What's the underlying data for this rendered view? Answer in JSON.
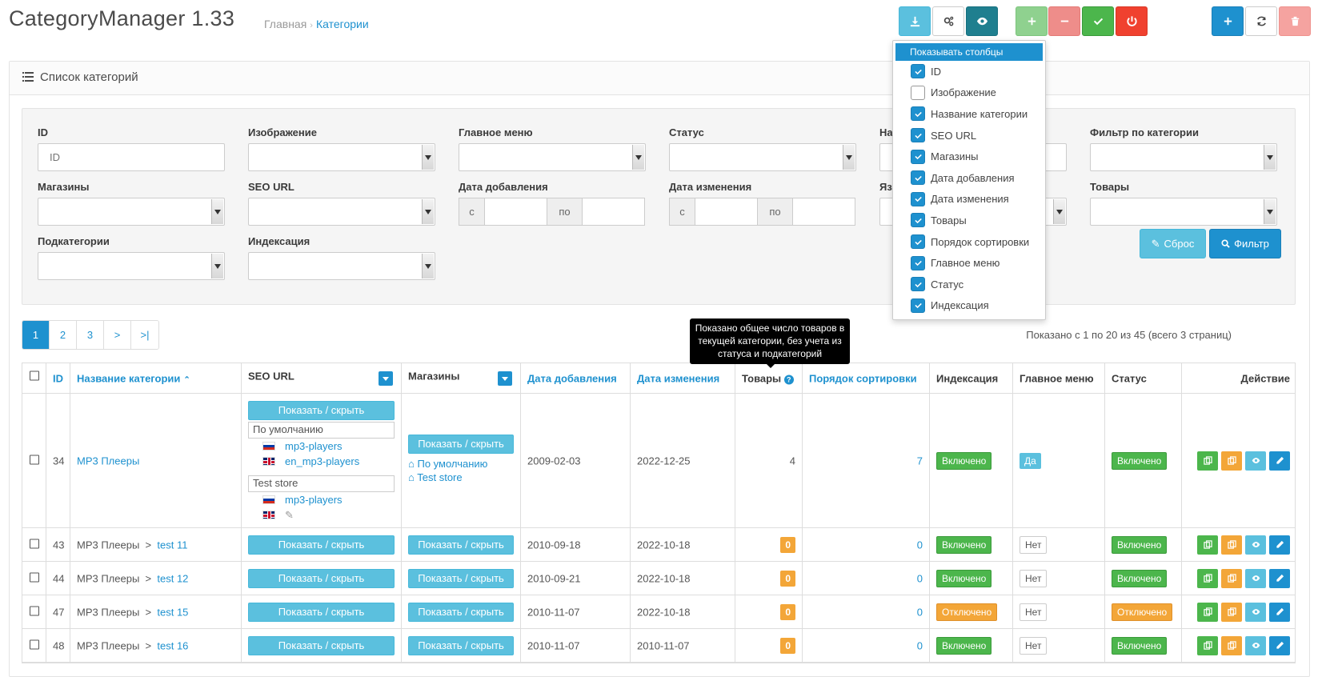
{
  "header": {
    "title": "CategoryManager 1.33",
    "breadcrumb": [
      "Главная",
      "Категории"
    ]
  },
  "toolbar": {
    "buttons": [
      {
        "icon": "download-icon",
        "color": "#5bc0de"
      },
      {
        "icon": "cogs-icon",
        "color": "#ffffff"
      },
      {
        "icon": "eye-icon",
        "color": "#1f7f8f"
      },
      {
        "icon": "plus-icon",
        "color": "#8fd18f"
      },
      {
        "icon": "minus-icon",
        "color": "#ee8d8a"
      },
      {
        "icon": "check-icon",
        "color": "#4cb64c"
      },
      {
        "icon": "power-icon",
        "color": "#f0412f"
      },
      {
        "icon": "plus-icon",
        "color": "#1e91cf"
      },
      {
        "icon": "refresh-icon",
        "color": "#ffffff"
      },
      {
        "icon": "trash-icon",
        "color": "#f5a3a0"
      }
    ]
  },
  "panel": {
    "title": "Список категорий"
  },
  "filters": {
    "id_label": "ID",
    "id_placeholder": "ID",
    "image_label": "Изображение",
    "main_menu_label": "Главное меню",
    "status_label": "Статус",
    "name_label_partial": "На",
    "category_filter_label": "Фильтр по категории",
    "stores_label": "Магазины",
    "seo_url_label": "SEO URL",
    "date_added_label": "Дата добавления",
    "date_modified_label": "Дата изменения",
    "language_label_partial": "Яз",
    "products_label": "Товары",
    "subcategories_label": "Подкатегории",
    "indexing_label": "Индексация",
    "date_from": "с",
    "date_to": "по",
    "reset_label": "Сброс",
    "filter_label": "Фильтр"
  },
  "pagination": {
    "pages": [
      "1",
      "2",
      "3",
      ">",
      ">|"
    ],
    "active": "1",
    "summary": "Показано с 1 по 20 из 45 (всего 3 страниц)"
  },
  "columns_menu": {
    "header": "Показывать столбцы",
    "options": [
      {
        "label": "ID",
        "checked": true
      },
      {
        "label": "Изображение",
        "checked": false
      },
      {
        "label": "Название категории",
        "checked": true
      },
      {
        "label": "SEO URL",
        "checked": true
      },
      {
        "label": "Магазины",
        "checked": true
      },
      {
        "label": "Дата добавления",
        "checked": true
      },
      {
        "label": "Дата изменения",
        "checked": true
      },
      {
        "label": "Товары",
        "checked": true
      },
      {
        "label": "Порядок сортировки",
        "checked": true
      },
      {
        "label": "Главное меню",
        "checked": true
      },
      {
        "label": "Статус",
        "checked": true
      },
      {
        "label": "Индексация",
        "checked": true
      }
    ]
  },
  "tooltip": {
    "text": "Показано общее число товаров в текущей категории, без учета из статуса и подкатегорий"
  },
  "table": {
    "headers": {
      "id": "ID",
      "name": "Название категории",
      "seo_url": "SEO URL",
      "stores": "Магазины",
      "date_added": "Дата добавления",
      "date_modified": "Дата изменения",
      "products": "Товары",
      "sort_order": "Порядок сортировки",
      "indexing": "Индексация",
      "main_menu": "Главное меню",
      "status": "Статус",
      "action": "Действие"
    },
    "show_hide_label": "Показать / скрыть",
    "first_row": {
      "id": "34",
      "name": "MP3 Плееры",
      "store_default": "По умолчанию",
      "store_test": "Test store",
      "seo_ru_1": "mp3-players",
      "seo_en_1": "en_mp3-players",
      "seo_ru_2": "mp3-players",
      "date_added": "2009-02-03",
      "date_modified": "2022-12-25",
      "products": "4",
      "sort_order": "7",
      "indexing": "Включено",
      "main_menu": "Да",
      "status": "Включено"
    },
    "rows": [
      {
        "id": "43",
        "parent": "MP3 Плееры",
        "sep": ">",
        "name": "test 11",
        "date_added": "2010-09-18",
        "date_modified": "2022-10-18",
        "products": "0",
        "sort_order": "0",
        "indexing": "Включено",
        "main_menu": "Нет",
        "status": "Включено",
        "enabled": true
      },
      {
        "id": "44",
        "parent": "MP3 Плееры",
        "sep": ">",
        "name": "test 12",
        "date_added": "2010-09-21",
        "date_modified": "2022-10-18",
        "products": "0",
        "sort_order": "0",
        "indexing": "Включено",
        "main_menu": "Нет",
        "status": "Включено",
        "enabled": true
      },
      {
        "id": "47",
        "parent": "MP3 Плееры",
        "sep": ">",
        "name": "test 15",
        "date_added": "2010-11-07",
        "date_modified": "2022-10-18",
        "products": "0",
        "sort_order": "0",
        "indexing": "Отключено",
        "main_menu": "Нет",
        "status": "Отключено",
        "enabled": false
      },
      {
        "id": "48",
        "parent": "MP3 Плееры",
        "sep": ">",
        "name": "test 16",
        "date_added": "2010-11-07",
        "date_modified": "2010-11-07",
        "products": "0",
        "sort_order": "0",
        "indexing": "Включено",
        "main_menu": "Нет",
        "status": "Включено",
        "enabled": true
      }
    ]
  },
  "colors": {
    "accent": "#1e91cf",
    "enabled": "#4cb64c",
    "disabled": "#f3a638",
    "info": "#5bc0de"
  }
}
